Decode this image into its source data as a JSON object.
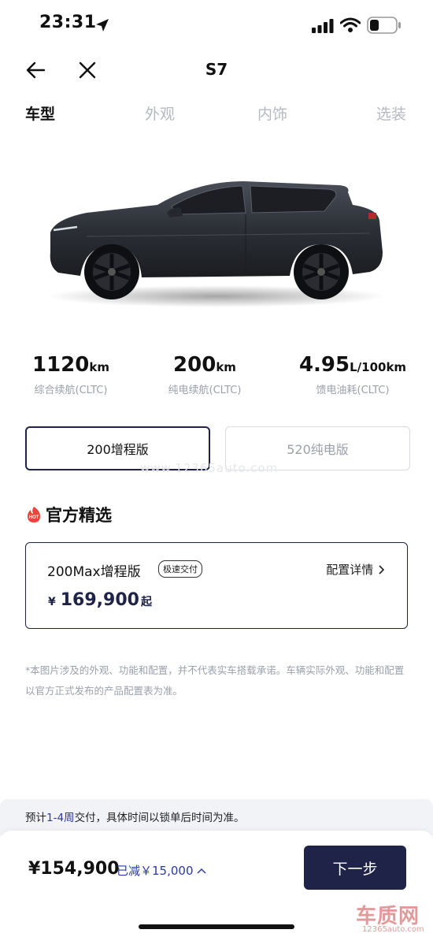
{
  "status_bar": {
    "time": "23:31"
  },
  "nav": {
    "title": "S7"
  },
  "tabs": [
    {
      "label": "车型",
      "active": true
    },
    {
      "label": "外观",
      "active": false
    },
    {
      "label": "内饰",
      "active": false
    },
    {
      "label": "选装",
      "active": false
    }
  ],
  "specs": [
    {
      "value": "1120",
      "unit": "km",
      "label": "综合续航(CLTC)"
    },
    {
      "value": "200",
      "unit": "km",
      "label": "纯电续航(CLTC)"
    },
    {
      "value": "4.95",
      "unit": "L/100km",
      "label": "馈电油耗(CLTC)"
    }
  ],
  "versions": {
    "selected": "200增程版",
    "other": "520纯电版"
  },
  "watermark": "www.12365auto.com",
  "official": {
    "hot_badge": "HOT",
    "title": "官方精选",
    "card": {
      "name": "200Max增程版",
      "badge": "极速交付",
      "config_link": "配置详情",
      "currency": "¥",
      "price": "169,900",
      "price_suffix": "起"
    }
  },
  "disclaimer": "*本图片涉及的外观、功能和配置，并不代表实车搭载承诺。车辆实际外观、功能和配置以官方正式发布的产品配置表为准。",
  "delivery": {
    "prefix": "预计",
    "highlight": "1-4周",
    "suffix": "交付，具体时间以锁单后时间为准。"
  },
  "bottom": {
    "total": "¥154,900",
    "discount": "已减￥15,000",
    "next_label": "下一步"
  },
  "site_logo": {
    "text": "车质网",
    "url": "12365auto.com"
  },
  "colors": {
    "brand_navy": "#1e2347",
    "accent_blue": "#2b3a9e",
    "hot_red": "#e8453c"
  }
}
